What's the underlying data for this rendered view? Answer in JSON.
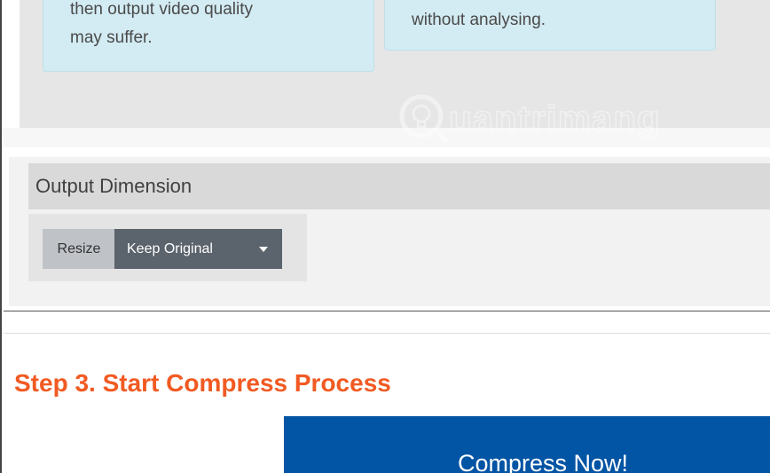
{
  "info_cards": [
    {
      "line1": "then output video quality",
      "line2": "may suffer."
    },
    {
      "line1": "without analysing."
    }
  ],
  "output_dimension": {
    "heading": "Output Dimension",
    "resize_label": "Resize",
    "selected_option": "Keep Original"
  },
  "step3": {
    "title": "Step 3. Start Compress Process",
    "button_label": "Compress Now!"
  },
  "watermark": {
    "text": "uantrimang"
  },
  "colors": {
    "step_title": "#f15a22",
    "compress_button": "#0254a4",
    "select_button": "#5b636c",
    "info_card": "#d3ebf2"
  }
}
